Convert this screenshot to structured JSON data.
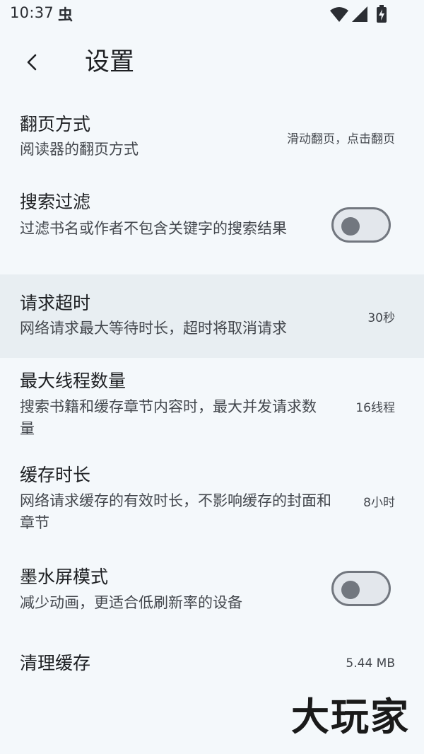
{
  "status_bar": {
    "time": "10:37",
    "debug_glyph": "虫",
    "icons": [
      "wifi-icon",
      "cellular-signal-icon",
      "battery-charging-icon"
    ]
  },
  "app_bar": {
    "back_icon": "chevron-left-icon",
    "title": "设置"
  },
  "settings": [
    {
      "title": "翻页方式",
      "description": "阅读器的翻页方式",
      "value": "滑动翻页，点击翻页"
    },
    {
      "title": "搜索过滤",
      "description": "过滤书名或作者不包含关键字的搜索结果",
      "toggle": false
    },
    {
      "title": "请求超时",
      "description": "网络请求最大等待时长，超时将取消请求",
      "value": "30秒"
    },
    {
      "title": "最大线程数量",
      "description": "搜索书籍和缓存章节内容时，最大并发请求数量",
      "value": "16线程"
    },
    {
      "title": "缓存时长",
      "description": "网络请求缓存的有效时长，不影响缓存的封面和章节",
      "value": "8小时"
    },
    {
      "title": "墨水屏模式",
      "description": "减少动画，更适合低刷新率的设备",
      "toggle": false
    },
    {
      "title": "清理缓存",
      "value": "5.44 MB"
    }
  ],
  "watermark": "大玩家",
  "colors": {
    "background": "#f4f8fb",
    "highlight_row": "#e8eef2",
    "toggle_outline": "#72777f",
    "toggle_track": "#e3e7ec"
  }
}
